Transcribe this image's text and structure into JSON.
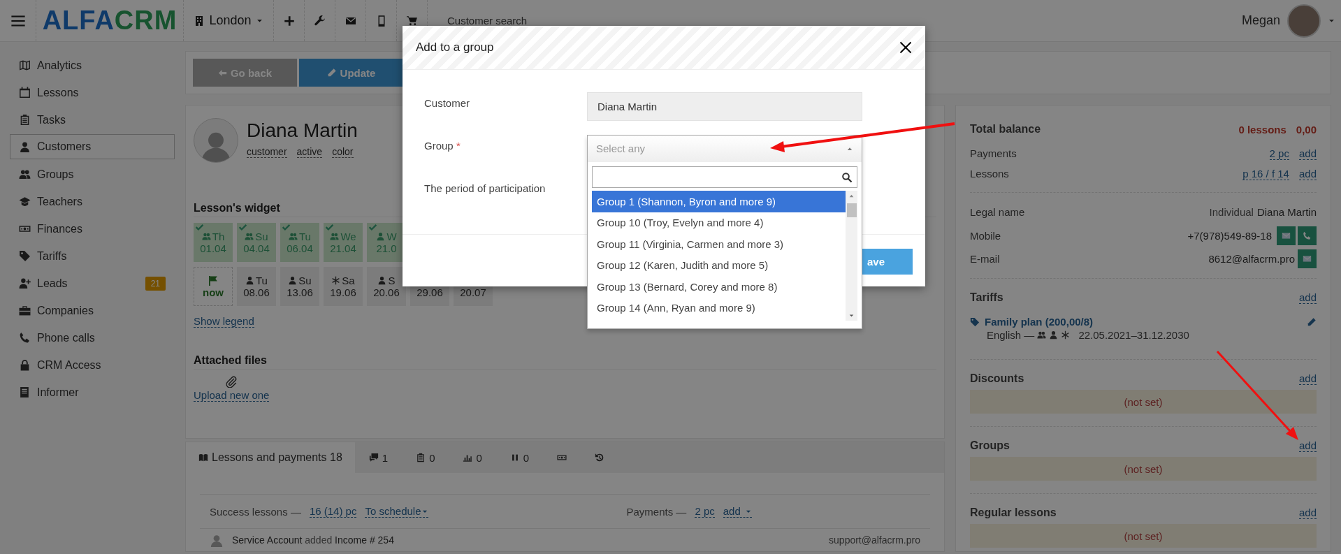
{
  "topbar": {
    "logo": {
      "part1": "ALFA",
      "part2": "CRM"
    },
    "branch": "London",
    "search": {
      "placeholder": "Customer search"
    },
    "user": {
      "name": "Megan"
    }
  },
  "sidebar": {
    "items": [
      {
        "label": "Analytics",
        "selected": false
      },
      {
        "label": "Lessons",
        "selected": false
      },
      {
        "label": "Tasks",
        "selected": false
      },
      {
        "label": "Customers",
        "selected": true
      },
      {
        "label": "Groups",
        "selected": false
      },
      {
        "label": "Teachers",
        "selected": false
      },
      {
        "label": "Finances",
        "selected": false
      },
      {
        "label": "Tariffs",
        "selected": false
      },
      {
        "label": "Leads",
        "selected": false,
        "badge": "21"
      },
      {
        "label": "Companies",
        "selected": false
      },
      {
        "label": "Phone calls",
        "selected": false
      },
      {
        "label": "CRM Access",
        "selected": false
      },
      {
        "label": "Informer",
        "selected": false
      }
    ]
  },
  "toolbar": {
    "buttons": [
      {
        "label": "Go back",
        "kind": "back"
      },
      {
        "label": "Update",
        "kind": "primary"
      }
    ]
  },
  "customer": {
    "name": "Diana Martin",
    "tags": [
      "customer",
      "active",
      "color"
    ]
  },
  "lesson_widget": {
    "title": "Lesson's widget",
    "rows": [
      [
        {
          "kind": "group",
          "done": true,
          "day": "Th",
          "date": "01.04"
        },
        {
          "kind": "group",
          "done": true,
          "day": "Su",
          "date": "04.04"
        },
        {
          "kind": "group",
          "done": true,
          "day": "Tu",
          "date": "06.04"
        },
        {
          "kind": "group",
          "done": true,
          "day": "We",
          "date": "21.04"
        },
        {
          "kind": "individual",
          "done": true,
          "day": "W",
          "date": "21.0"
        }
      ],
      [
        {
          "kind": "now",
          "done": false,
          "date": "now"
        },
        {
          "kind": "individual",
          "done": false,
          "day": "Tu",
          "date": "08.06"
        },
        {
          "kind": "individual",
          "done": false,
          "day": "Su",
          "date": "13.06"
        },
        {
          "kind": "trial",
          "done": false,
          "day": "Sa",
          "date": "19.06"
        },
        {
          "kind": "individual",
          "done": false,
          "day": "S",
          "date": "20.06"
        },
        {
          "done": false,
          "date": "29.06"
        },
        {
          "done": false,
          "date": "20.07"
        }
      ]
    ],
    "legend_link": "Show legend"
  },
  "attached_files": {
    "title": "Attached files",
    "upload_link": "Upload new one"
  },
  "tabs": [
    {
      "label": "Lessons and payments 18",
      "selected": true
    },
    {
      "label": "1",
      "selected": false
    },
    {
      "label": "0",
      "selected": false
    },
    {
      "label": "0",
      "selected": false
    },
    {
      "label": "0",
      "selected": false
    },
    {
      "selected": false
    },
    {
      "selected": false
    }
  ],
  "lessons_summary": {
    "label": "Success lessons —",
    "count": "16 (14) pc",
    "schedule": "To schedule",
    "payments_label": "Payments —",
    "payments_count": "2 pc",
    "add": "add"
  },
  "activity": [
    {
      "parts": [
        "Service Account",
        "added",
        "Income # 254"
      ],
      "author": "support@alfacrm.pro"
    }
  ],
  "balance": {
    "title": "Total balance",
    "lessons": "0 lessons",
    "amount": "0,00",
    "rows": [
      {
        "label": "Payments",
        "value": "2 pc",
        "action": "add"
      },
      {
        "label": "Lessons",
        "value": "p 16 / f 14",
        "action": "add"
      }
    ]
  },
  "contacts": {
    "legal": {
      "label": "Legal name",
      "type": "Individual",
      "name": "Diana Martin"
    },
    "mobile": {
      "label": "Mobile",
      "value": "+7(978)549-89-18"
    },
    "email": {
      "label": "E-mail",
      "value": "8612@alfacrm.pro"
    }
  },
  "tariffs": {
    "title": "Tariffs",
    "action": "add",
    "items": [
      {
        "name": "Family plan (200,00/8)",
        "subject": "English —",
        "period": "22.05.2021–31.12.2030"
      }
    ]
  },
  "sections": [
    {
      "title": "Discounts",
      "action": "add",
      "empty": "(not set)"
    },
    {
      "title": "Groups",
      "action": "add",
      "empty": "(not set)"
    },
    {
      "title": "Regular lessons",
      "action": "add",
      "empty": "(not set)"
    }
  ],
  "modal": {
    "title": "Add to a group",
    "fields": [
      {
        "label": "Customer",
        "value": "Diana Martin"
      },
      {
        "label": "Group",
        "required": true,
        "mark": "*",
        "placeholder": "Select any"
      },
      {
        "label": "The period of participation"
      }
    ],
    "dropdown": {
      "expanded": true,
      "options": [
        {
          "label": "Group 1 (Shannon, Byron and more 9)",
          "selected": true
        },
        {
          "label": "Group 10 (Troy, Evelyn and more 4)",
          "selected": false
        },
        {
          "label": "Group 11 (Virginia, Carmen and more 3)",
          "selected": false
        },
        {
          "label": "Group 12 (Karen, Judith and more 5)",
          "selected": false
        },
        {
          "label": "Group 13 (Bernard, Corey and more 8)",
          "selected": false
        },
        {
          "label": "Group 14 (Ann, Ryan and more 9)",
          "selected": false
        }
      ]
    },
    "save_button": "ave"
  }
}
